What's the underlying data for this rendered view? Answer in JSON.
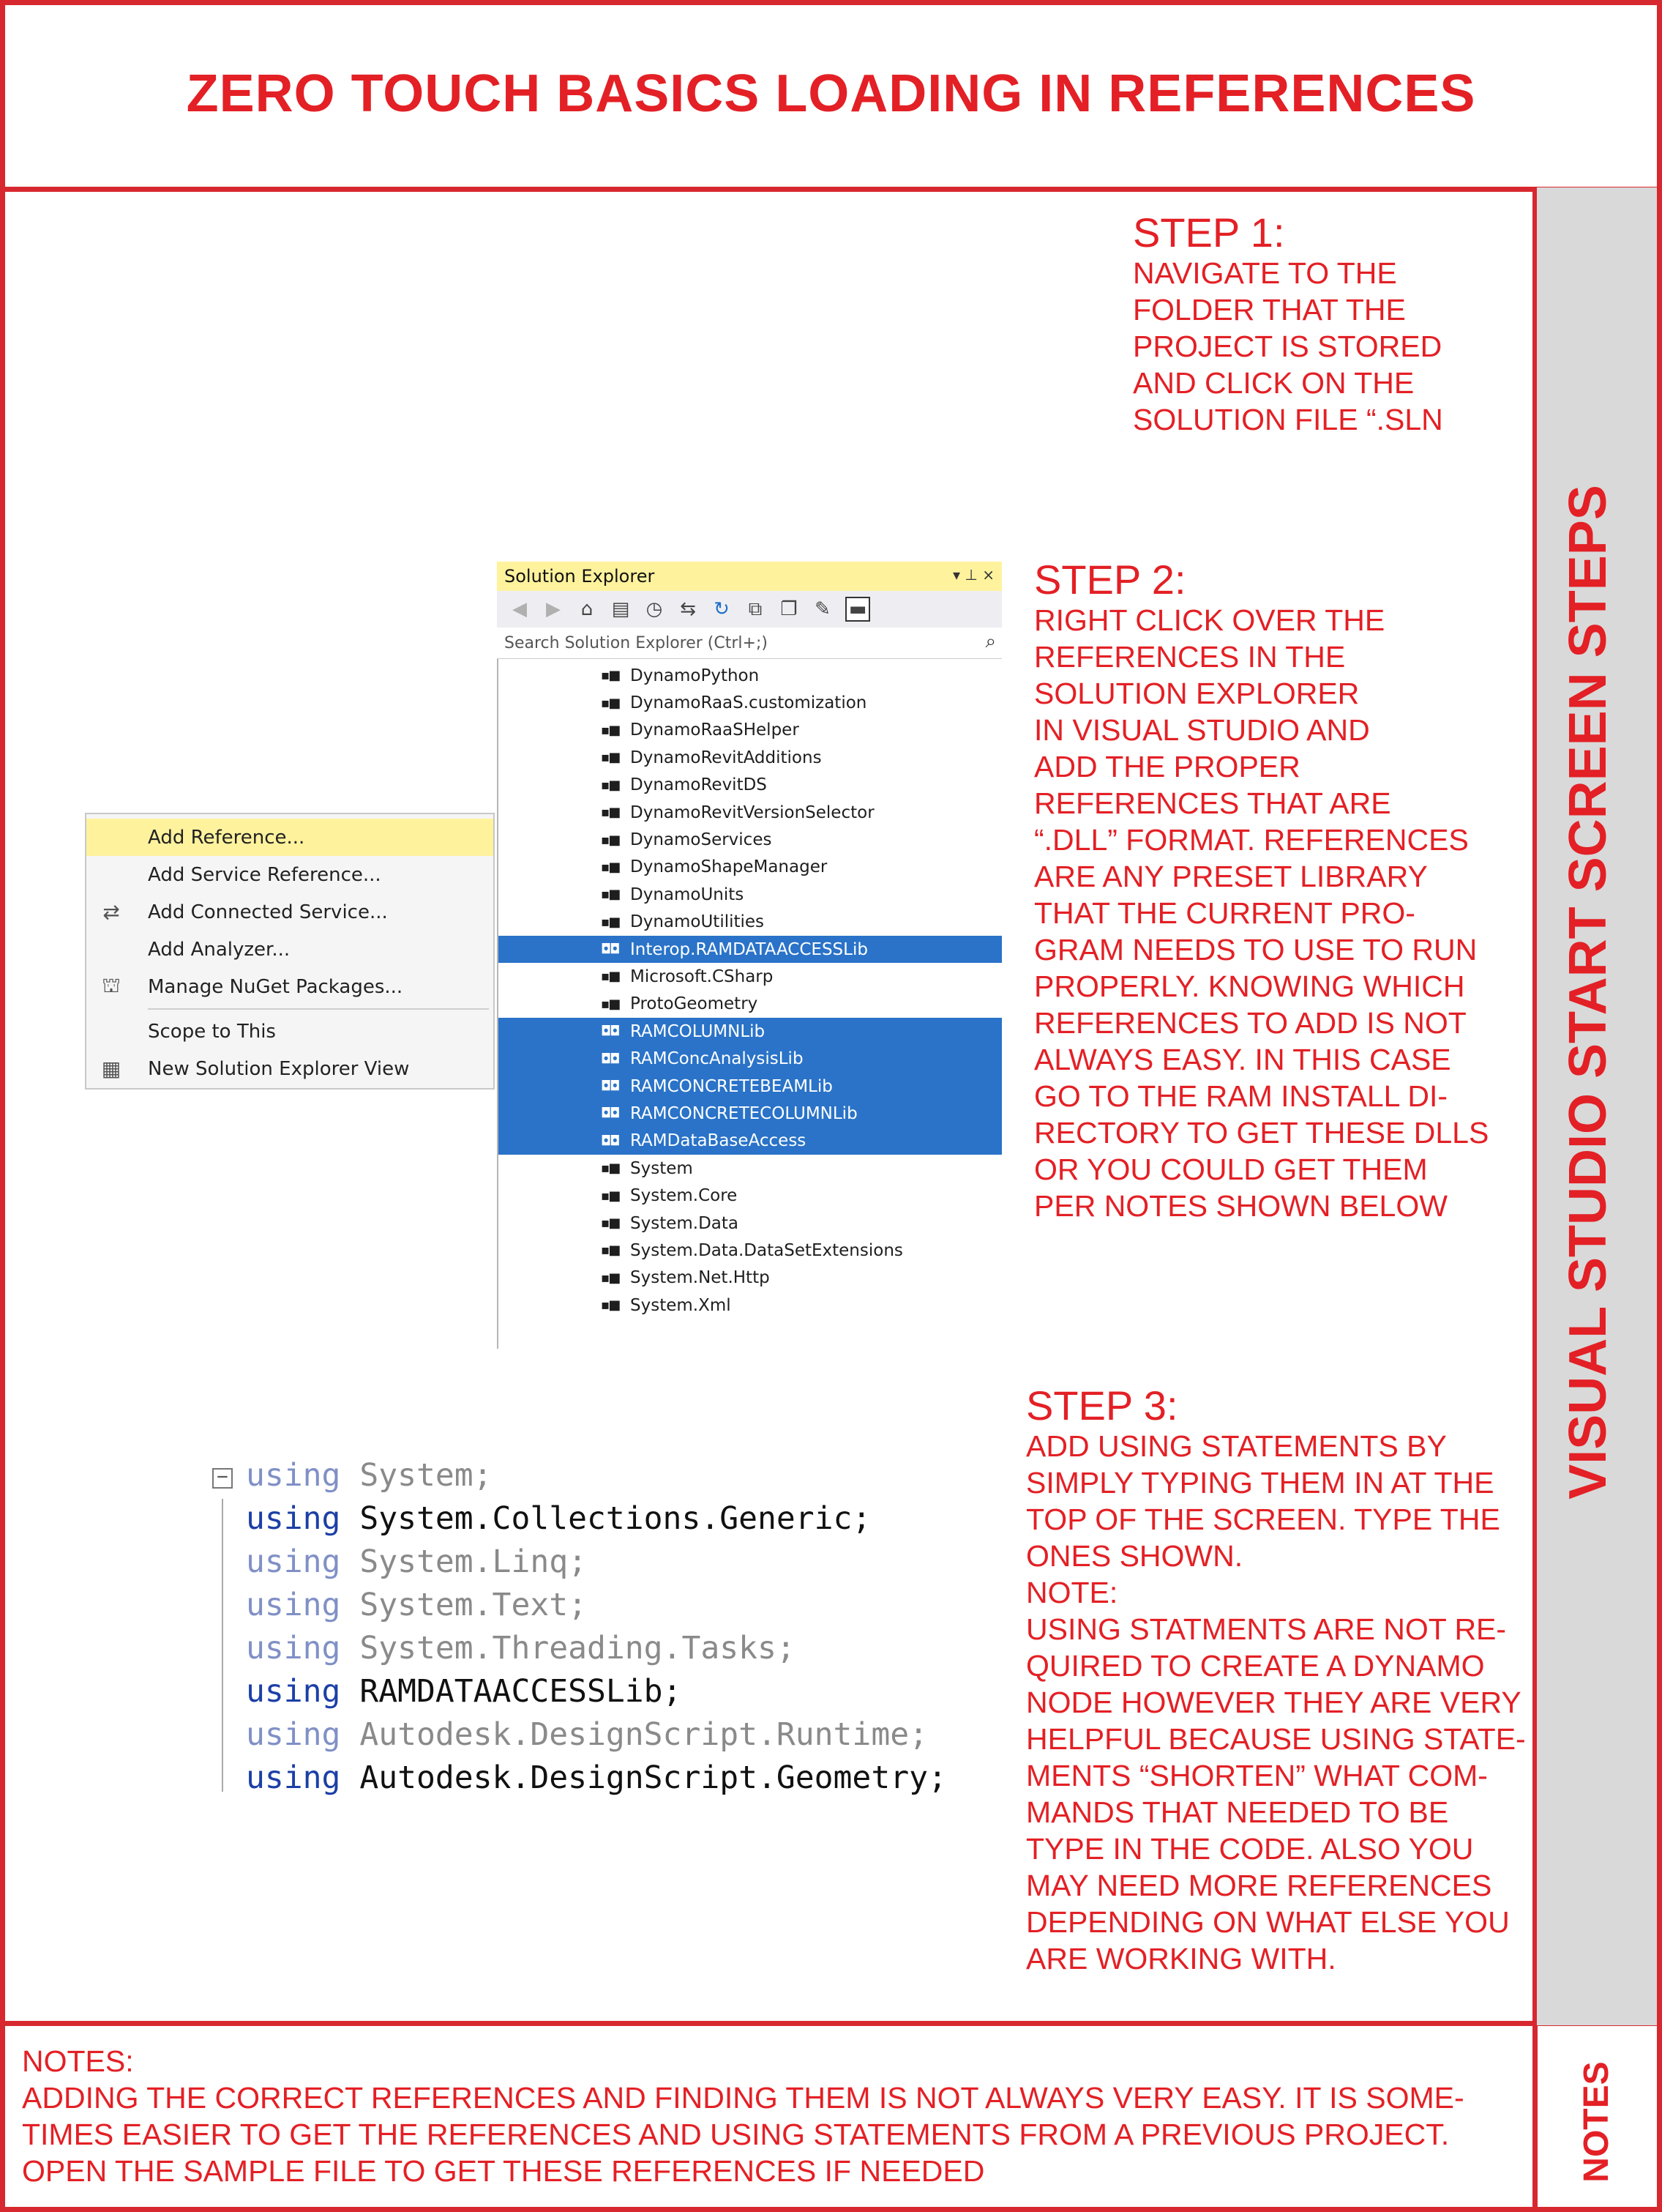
{
  "title": "ZERO TOUCH BASICS LOADING IN REFERENCES",
  "sidebar_label": "VISUAL STUDIO START SCREEN STEPS",
  "notes_tab_label": "NOTES",
  "colors": {
    "accent_red": "#e32025",
    "border_red": "#d7282f",
    "sidebar_gray": "#d9d9d9",
    "selection_blue": "#2a73c8",
    "highlight_yellow": "#fff29d"
  },
  "step1": {
    "heading": "STEP 1:",
    "lines": [
      "NAVIGATE TO THE",
      "FOLDER THAT THE",
      "PROJECT IS STORED",
      "AND CLICK ON THE",
      "SOLUTION FILE “.SLN"
    ]
  },
  "step2": {
    "heading": "STEP 2:",
    "lines": [
      "RIGHT CLICK OVER THE",
      "REFERENCES IN THE",
      "SOLUTION EXPLORER",
      "IN VISUAL STUDIO AND",
      "ADD THE PROPER",
      "REFERENCES THAT ARE",
      "“.DLL” FORMAT. REFERENCES",
      "ARE ANY PRESET LIBRARY",
      "THAT THE CURRENT PRO-",
      "GRAM NEEDS TO USE TO RUN",
      "PROPERLY. KNOWING WHICH",
      "REFERENCES TO ADD IS NOT",
      "ALWAYS EASY. IN THIS CASE",
      "GO TO THE RAM INSTALL DI-",
      "RECTORY TO GET THESE DLLS",
      "OR YOU COULD GET THEM",
      "PER NOTES SHOWN BELOW"
    ]
  },
  "step3": {
    "heading": "STEP 3:",
    "lines": [
      "ADD USING STATEMENTS BY",
      "SIMPLY TYPING THEM IN AT THE",
      "TOP OF THE SCREEN. TYPE THE",
      "ONES SHOWN.",
      "NOTE:",
      "USING STATMENTS ARE NOT RE-",
      "QUIRED TO CREATE A DYNAMO",
      "NODE HOWEVER THEY ARE VERY",
      "HELPFUL BECAUSE USING STATE-",
      "MENTS “SHORTEN” WHAT COM-",
      "MANDS THAT NEEDED TO BE",
      "TYPE IN THE CODE. ALSO YOU",
      "MAY NEED MORE REFERENCES",
      "DEPENDING ON WHAT ELSE YOU",
      "ARE WORKING WITH."
    ]
  },
  "notes": {
    "lines": [
      "NOTES:",
      "ADDING THE CORRECT REFERENCES AND FINDING THEM IS NOT ALWAYS VERY EASY. IT IS SOME-",
      "TIMES EASIER TO GET THE REFERENCES AND USING STATEMENTS FROM A PREVIOUS PROJECT.",
      "OPEN THE SAMPLE FILE TO GET THESE REFERENCES IF NEEDED"
    ]
  },
  "solution_explorer": {
    "title": "Solution Explorer",
    "search_placeholder": "Search Solution Explorer (Ctrl+;)",
    "items": [
      {
        "label": "DynamoPython",
        "selected": false
      },
      {
        "label": "DynamoRaaS.customization",
        "selected": false
      },
      {
        "label": "DynamoRaaSHelper",
        "selected": false
      },
      {
        "label": "DynamoRevitAdditions",
        "selected": false
      },
      {
        "label": "DynamoRevitDS",
        "selected": false
      },
      {
        "label": "DynamoRevitVersionSelector",
        "selected": false
      },
      {
        "label": "DynamoServices",
        "selected": false
      },
      {
        "label": "DynamoShapeManager",
        "selected": false
      },
      {
        "label": "DynamoUnits",
        "selected": false
      },
      {
        "label": "DynamoUtilities",
        "selected": false
      },
      {
        "label": "Interop.RAMDATAACCESSLib",
        "selected": true
      },
      {
        "label": "Microsoft.CSharp",
        "selected": false
      },
      {
        "label": "ProtoGeometry",
        "selected": false
      },
      {
        "label": "RAMCOLUMNLib",
        "selected": true
      },
      {
        "label": "RAMConcAnalysisLib",
        "selected": true
      },
      {
        "label": "RAMCONCRETEBEAMLib",
        "selected": true
      },
      {
        "label": "RAMCONCRETECOLUMNLib",
        "selected": true
      },
      {
        "label": "RAMDataBaseAccess",
        "selected": true
      },
      {
        "label": "System",
        "selected": false
      },
      {
        "label": "System.Core",
        "selected": false
      },
      {
        "label": "System.Data",
        "selected": false
      },
      {
        "label": "System.Data.DataSetExtensions",
        "selected": false
      },
      {
        "label": "System.Net.Http",
        "selected": false
      },
      {
        "label": "System.Xml",
        "selected": false
      }
    ]
  },
  "context_menu": {
    "items": [
      {
        "label": "Add Reference...",
        "icon": "",
        "highlighted": true
      },
      {
        "label": "Add Service Reference...",
        "icon": "",
        "highlighted": false
      },
      {
        "label": "Add Connected Service...",
        "icon": "connected-service-icon",
        "highlighted": false
      },
      {
        "label": "Add Analyzer...",
        "icon": "",
        "highlighted": false
      },
      {
        "label": "Manage NuGet Packages...",
        "icon": "nuget-icon",
        "highlighted": false
      },
      {
        "label": "Scope to This",
        "icon": "",
        "highlighted": false
      },
      {
        "label": "New Solution Explorer View",
        "icon": "new-view-icon",
        "highlighted": false
      }
    ]
  },
  "code": {
    "lines": [
      {
        "kw": "using",
        "ns": " System;",
        "dim": true
      },
      {
        "kw": "using",
        "ns": " System.Collections.Generic;",
        "dim": false
      },
      {
        "kw": "using",
        "ns": " System.Linq;",
        "dim": true
      },
      {
        "kw": "using",
        "ns": " System.Text;",
        "dim": true
      },
      {
        "kw": "using",
        "ns": " System.Threading.Tasks;",
        "dim": true
      },
      {
        "kw": "using",
        "ns": " RAMDATAACCESSLib;",
        "dim": false
      },
      {
        "kw": "using",
        "ns": " Autodesk.DesignScript.Runtime;",
        "dim": true
      },
      {
        "kw": "using",
        "ns": " Autodesk.DesignScript.Geometry;",
        "dim": false
      }
    ]
  }
}
